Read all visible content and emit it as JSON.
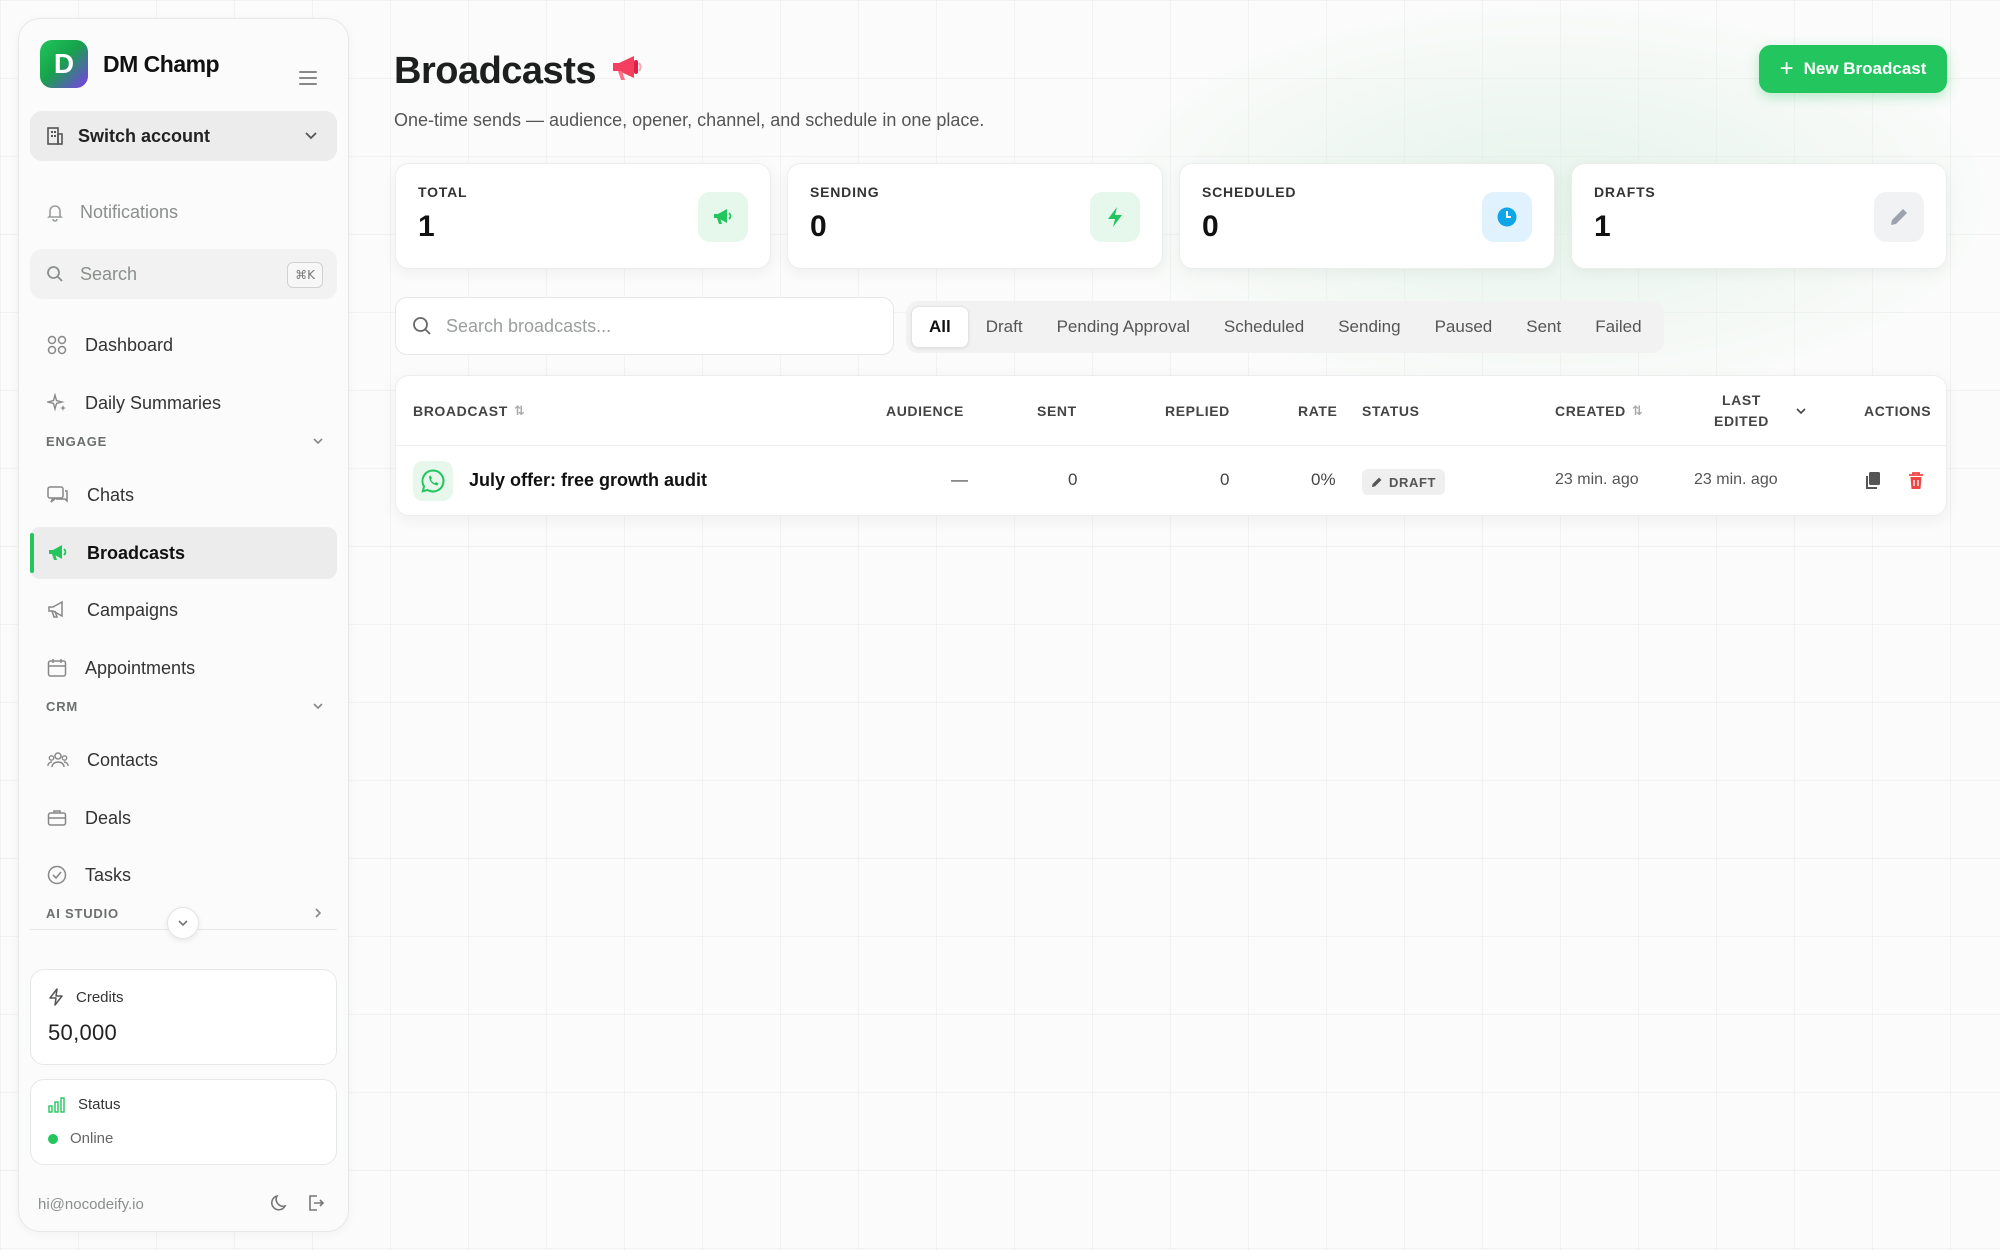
{
  "brand": {
    "name": "DM Champ",
    "logo_letter": "D"
  },
  "sidebar": {
    "switch_account": "Switch account",
    "notifications": "Notifications",
    "search": {
      "label": "Search",
      "shortcut": "⌘K"
    },
    "items_top": [
      {
        "label": "Dashboard"
      },
      {
        "label": "Daily Summaries"
      }
    ],
    "sections": {
      "engage": "ENGAGE",
      "crm": "CRM",
      "ai_studio": "AI STUDIO"
    },
    "engage_items": [
      {
        "label": "Chats"
      },
      {
        "label": "Broadcasts"
      },
      {
        "label": "Campaigns"
      },
      {
        "label": "Appointments"
      }
    ],
    "crm_items": [
      {
        "label": "Contacts"
      },
      {
        "label": "Deals"
      },
      {
        "label": "Tasks"
      }
    ],
    "credits": {
      "label": "Credits",
      "value": "50,000"
    },
    "status": {
      "label": "Status",
      "value": "Online"
    },
    "footer_email": "hi@nocodeify.io"
  },
  "main": {
    "title": "Broadcasts",
    "title_emoji": "📢",
    "subtitle": "One-time sends — audience, opener, channel, and schedule in one place.",
    "new_button": "New Broadcast",
    "stats": [
      {
        "label": "TOTAL",
        "value": "1",
        "icon": "megaphone-icon",
        "color": "#22c55e"
      },
      {
        "label": "SENDING",
        "value": "0",
        "icon": "bolt-icon",
        "color": "#22c55e"
      },
      {
        "label": "SCHEDULED",
        "value": "0",
        "icon": "clock-icon",
        "color": "#0ea5e9"
      },
      {
        "label": "DRAFTS",
        "value": "1",
        "icon": "pencil-icon",
        "color": "#9ca3af"
      }
    ],
    "search_placeholder": "Search broadcasts...",
    "filters": [
      "All",
      "Draft",
      "Pending Approval",
      "Scheduled",
      "Sending",
      "Paused",
      "Sent",
      "Failed"
    ],
    "table": {
      "columns": {
        "broadcast": "BROADCAST",
        "audience": "AUDIENCE",
        "sent": "SENT",
        "replied": "REPLIED",
        "rate": "RATE",
        "status": "STATUS",
        "created": "CREATED",
        "last_edited_1": "LAST",
        "last_edited_2": "EDITED",
        "actions": "ACTIONS"
      },
      "rows": [
        {
          "name": "July offer: free growth audit",
          "audience": "—",
          "sent": "0",
          "replied": "0",
          "rate": "0%",
          "status": "DRAFT",
          "created": "23 min. ago",
          "last_edited": "23 min. ago"
        }
      ]
    }
  }
}
